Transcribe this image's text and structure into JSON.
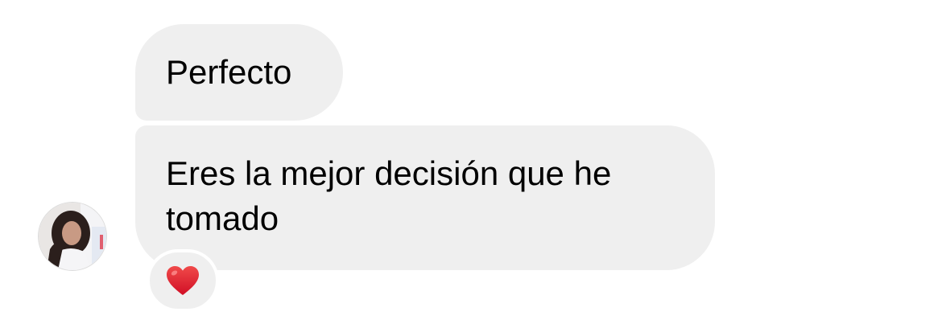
{
  "messages": [
    {
      "text": "Perfecto"
    },
    {
      "text": "Eres la mejor decisión que he tomado"
    }
  ],
  "reaction": {
    "icon": "red-heart-icon",
    "color": "#e0142b"
  },
  "colors": {
    "bubble": "#efefef",
    "background": "#ffffff"
  }
}
